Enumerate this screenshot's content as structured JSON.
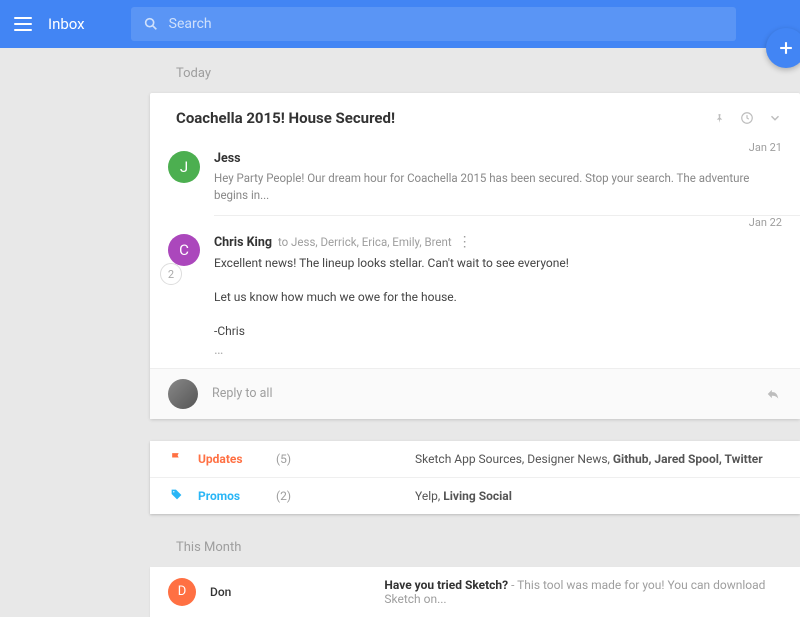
{
  "header": {
    "app_title": "Inbox",
    "search_placeholder": "Search"
  },
  "sections": {
    "today": "Today",
    "this_month": "This Month"
  },
  "thread": {
    "title": "Coachella 2015! House Secured!",
    "collapsed_count": "2",
    "messages": [
      {
        "avatar_letter": "J",
        "avatar_color": "#4caf50",
        "sender": "Jess",
        "date": "Jan 21",
        "preview": "Hey Party People! Our dream hour for Coachella 2015 has been secured. Stop your search. The adventure begins in..."
      },
      {
        "avatar_letter": "C",
        "avatar_color": "#ab47bc",
        "sender": "Chris King",
        "recipients": "to Jess, Derrick, Erica, Emily, Brent",
        "date": "Jan 22",
        "body_line1": "Excellent news! The lineup looks stellar. Can't wait to see everyone!",
        "body_line2": "Let us know how much we owe for the house.",
        "body_line3": "-Chris"
      }
    ],
    "reply_placeholder": "Reply to all"
  },
  "bundles": [
    {
      "name": "Updates",
      "count": "(5)",
      "class": "updates",
      "icon": "flag",
      "sources_plain": "Sketch App Sources, Designer News, ",
      "sources_bold": "Github, Jared Spool, Twitter"
    },
    {
      "name": "Promos",
      "count": "(2)",
      "class": "promos",
      "icon": "tag",
      "sources_plain": "Yelp, ",
      "sources_bold": "Living Social"
    }
  ],
  "month_row": {
    "avatar_letter": "D",
    "avatar_color": "#ff7043",
    "sender": "Don",
    "subject": "Have you tried Sketch?",
    "preview": " - This tool was made for you! You can download Sketch on..."
  }
}
